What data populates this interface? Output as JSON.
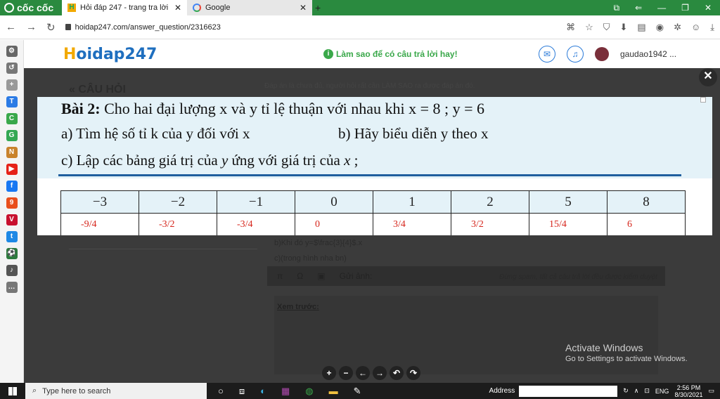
{
  "browser": {
    "brand": "cốc cốc",
    "tabs": [
      {
        "title": "Hỏi đáp 247 - trang tra lời",
        "active": true
      },
      {
        "title": "Google",
        "active": false
      }
    ],
    "url": "hoidap247.com/answer_question/2316623"
  },
  "site": {
    "logo_prefix": "H",
    "logo_rest": "oidap247",
    "howto": "Làm sao để có câu trả lời hay!",
    "username": "gaudao1942 ..."
  },
  "page": {
    "section_title": "« CÂU HỎI",
    "dim_note": "Đáp án là chưa đủ, người hỏi rất cần LÀM SAO ra được đáp án đó.",
    "answer_line_b": "b)Khi đó y=$\\frac{3}{4}$.x",
    "answer_line_c": "c)(trong hình nha bn)",
    "editor_pi": "π",
    "editor_omega": "Ω",
    "editor_attach": "Gửi ảnh:",
    "editor_note": "Đừng spam, tất cả câu trả lời đều được kiểm duyệt",
    "preview_label": "Xem trước:"
  },
  "image": {
    "bai_label": "Bài 2:",
    "bai_text": " Cho hai đại lượng x và y tỉ lệ thuận với nhau khi x = 8 ; y = 6",
    "qa": "a) Tìm hệ số tỉ k của y đối với x",
    "qb": "b) Hãy biểu diễn y theo x",
    "qc_pre": "c)  Lập các bảng giá trị của ",
    "qc_var1": "y",
    "qc_mid": "  ứng với giá trị của ",
    "qc_var2": "x",
    "qc_end": " ;",
    "x_values": [
      "−3",
      "−2",
      "−1",
      "0",
      "1",
      "2",
      "5",
      "8"
    ],
    "y_values": [
      "-9/4",
      "-3/2",
      "-3/4",
      "0",
      "3/4",
      "3/2",
      "15/4",
      "6"
    ]
  },
  "watermark": {
    "line1": "Activate Windows",
    "line2": "Go to Settings to activate Windows."
  },
  "taskbar": {
    "search_placeholder": "Type here to search",
    "address_label": "Address",
    "lang": "ENG",
    "time": "2:56 PM",
    "date": "8/30/2021"
  }
}
